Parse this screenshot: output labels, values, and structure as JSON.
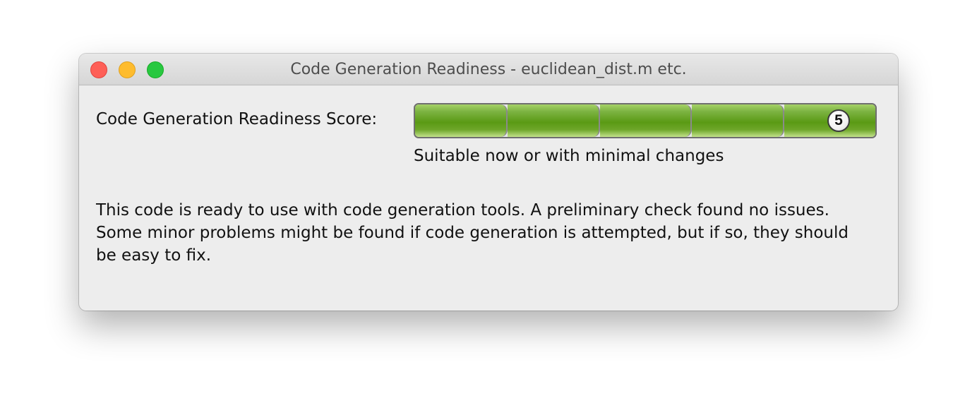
{
  "window": {
    "title": "Code Generation Readiness - euclidean_dist.m etc.",
    "controls": [
      "close",
      "minimize",
      "zoom"
    ]
  },
  "score": {
    "label": "Code Generation Readiness Score:",
    "value": "5",
    "max": 5,
    "fill_color": "#5a9a14",
    "description": "Suitable now or with minimal changes"
  },
  "message": "This code is ready to use with code generation tools. A preliminary check found no issues. Some minor problems might be found if code generation is attempted, but if so, they should be easy to fix."
}
